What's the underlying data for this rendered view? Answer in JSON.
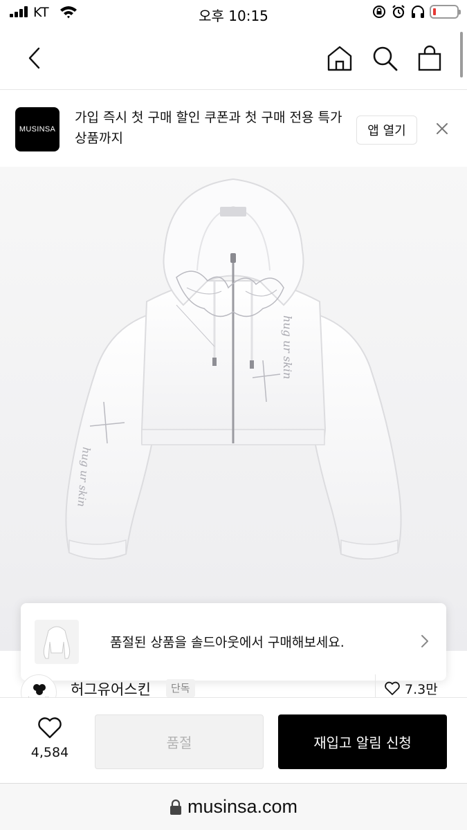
{
  "status_bar": {
    "carrier": "KT",
    "time": "오후 10:15",
    "battery_level": 0.1
  },
  "nav": {
    "back_icon": "chevron-left-icon",
    "home_icon": "home-icon",
    "search_icon": "search-icon",
    "cart_icon": "shopping-bag-icon"
  },
  "app_banner": {
    "logo_text": "MUSINSA",
    "message": "가입 즉시 첫 구매 할인 쿠폰과 첫 구매 전용 특가 상품까지",
    "open_app_label": "앱 열기",
    "close_icon": "close-icon"
  },
  "product": {
    "image_label": "hugyourskin"
  },
  "soldout_notice": {
    "text": "품절된 상품을 솔드아웃에서 구매해보세요.",
    "chevron_icon": "chevron-right-icon"
  },
  "brand": {
    "logo_text": "hugyourskin",
    "name": "허그유어스킨",
    "badge": "단독",
    "like_count": "7.3만",
    "like_icon": "heart-outline-icon"
  },
  "action_bar": {
    "wish_count": "4,584",
    "soldout_label": "품절",
    "restock_label": "재입고 알림 신청"
  },
  "url_bar": {
    "url": "musinsa.com",
    "lock_icon": "lock-icon"
  }
}
